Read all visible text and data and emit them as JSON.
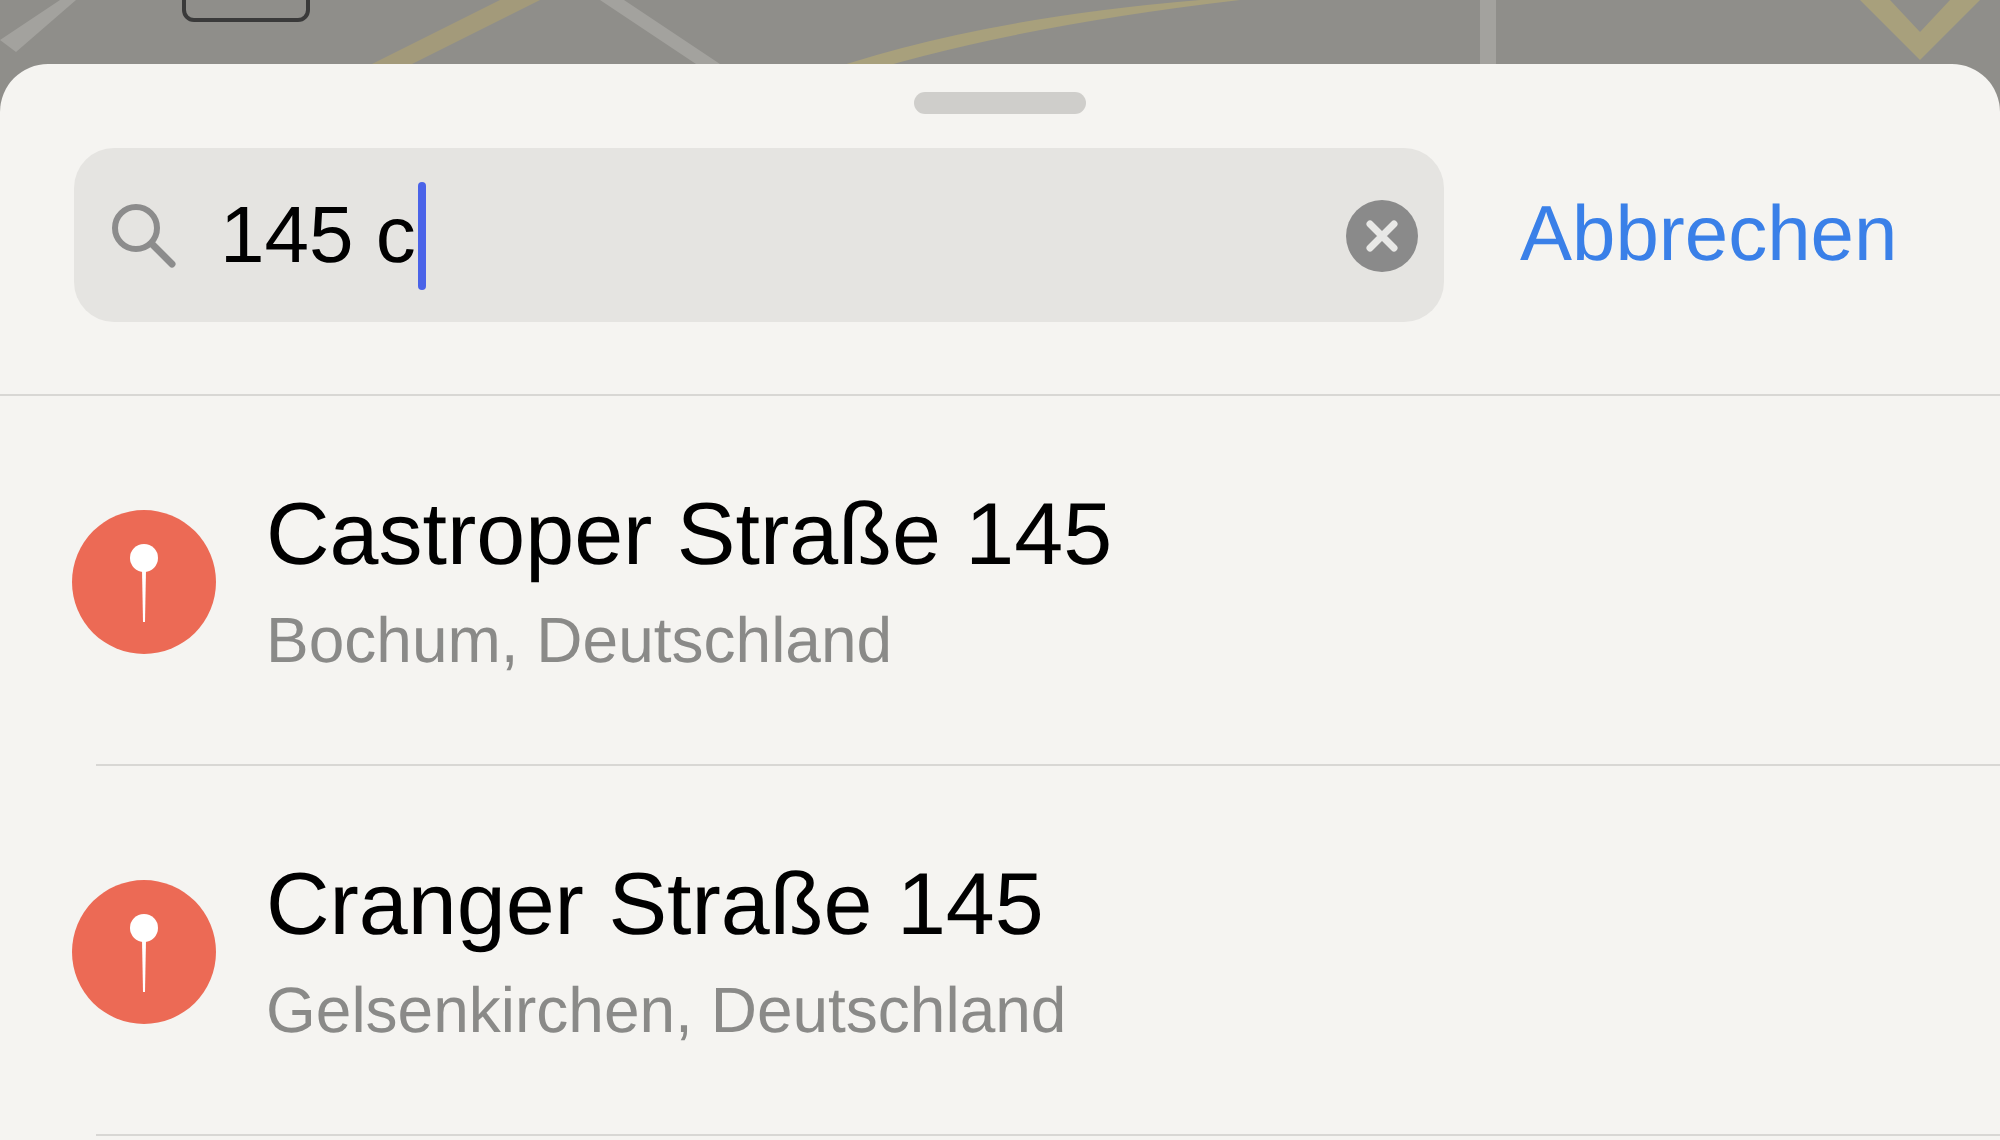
{
  "search": {
    "value": "145 c"
  },
  "cancel_button": "Abbrechen",
  "results": [
    {
      "title": "Castroper Straße 145",
      "subtitle": "Bochum, Deutschland"
    },
    {
      "title": "Cranger Straße 145",
      "subtitle": "Gelsenkirchen, Deutschland"
    }
  ]
}
